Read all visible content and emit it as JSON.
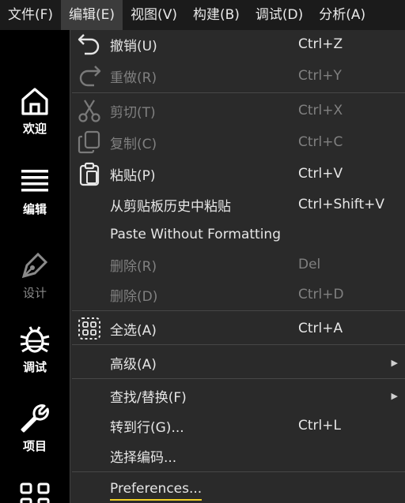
{
  "menubar": {
    "items": [
      {
        "label": "文件(F)"
      },
      {
        "label": "编辑(E)"
      },
      {
        "label": "视图(V)"
      },
      {
        "label": "构建(B)"
      },
      {
        "label": "调试(D)"
      },
      {
        "label": "分析(A)"
      }
    ]
  },
  "sidebar": {
    "modes": [
      {
        "label": "欢迎",
        "icon": "home-icon"
      },
      {
        "label": "编辑",
        "icon": "edit-lines-icon"
      },
      {
        "label": "设计",
        "icon": "pen-nib-icon"
      },
      {
        "label": "调试",
        "icon": "bug-icon"
      },
      {
        "label": "项目",
        "icon": "wrench-icon"
      }
    ]
  },
  "edit_menu": {
    "undo": {
      "label": "撤销(U)",
      "shortcut": "Ctrl+Z"
    },
    "redo": {
      "label": "重做(R)",
      "shortcut": "Ctrl+Y"
    },
    "cut": {
      "label": "剪切(T)",
      "shortcut": "Ctrl+X"
    },
    "copy": {
      "label": "复制(C)",
      "shortcut": "Ctrl+C"
    },
    "paste": {
      "label": "粘贴(P)",
      "shortcut": "Ctrl+V"
    },
    "paste_history": {
      "label": "从剪贴板历史中粘贴",
      "shortcut": "Ctrl+Shift+V"
    },
    "paste_plain": {
      "label": "Paste Without Formatting"
    },
    "delete1": {
      "label": "删除(R)",
      "shortcut": "Del"
    },
    "delete2": {
      "label": "删除(D)",
      "shortcut": "Ctrl+D"
    },
    "select_all": {
      "label": "全选(A)",
      "shortcut": "Ctrl+A"
    },
    "advanced": {
      "label": "高级(A)"
    },
    "find_replace": {
      "label": "查找/替换(F)"
    },
    "goto_line": {
      "label": "转到行(G)...",
      "shortcut": "Ctrl+L"
    },
    "select_encoding": {
      "label": "选择编码..."
    },
    "preferences": {
      "label": "Preferences..."
    }
  },
  "colors": {
    "menubar_bg": "#1b1b1b",
    "dropdown_bg": "#2a2a2a",
    "sidebar_bg": "#000000",
    "disabled_text": "#808080",
    "focus_underline": "#f0d028"
  }
}
